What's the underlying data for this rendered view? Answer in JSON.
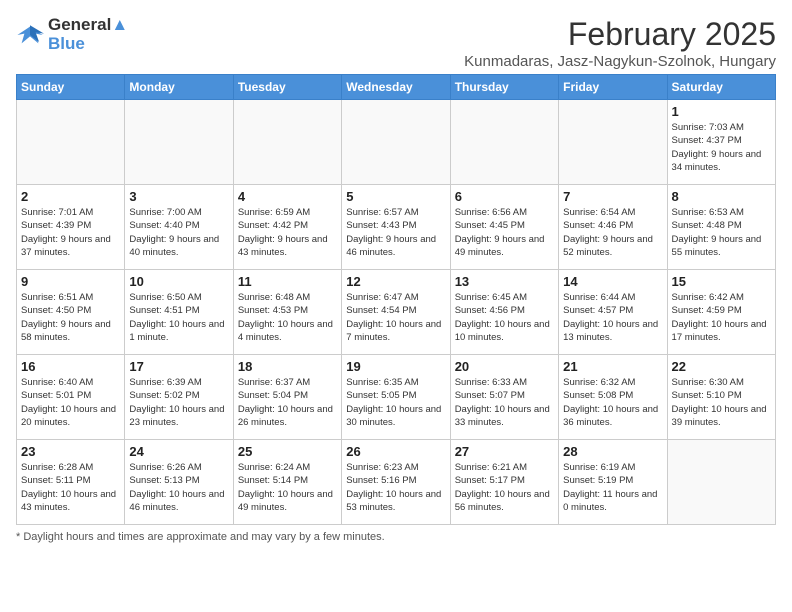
{
  "header": {
    "logo_line1": "General",
    "logo_line2": "Blue",
    "month_year": "February 2025",
    "location": "Kunmadaras, Jasz-Nagykun-Szolnok, Hungary"
  },
  "days_of_week": [
    "Sunday",
    "Monday",
    "Tuesday",
    "Wednesday",
    "Thursday",
    "Friday",
    "Saturday"
  ],
  "weeks": [
    [
      {
        "day": "",
        "info": ""
      },
      {
        "day": "",
        "info": ""
      },
      {
        "day": "",
        "info": ""
      },
      {
        "day": "",
        "info": ""
      },
      {
        "day": "",
        "info": ""
      },
      {
        "day": "",
        "info": ""
      },
      {
        "day": "1",
        "info": "Sunrise: 7:03 AM\nSunset: 4:37 PM\nDaylight: 9 hours and 34 minutes."
      }
    ],
    [
      {
        "day": "2",
        "info": "Sunrise: 7:01 AM\nSunset: 4:39 PM\nDaylight: 9 hours and 37 minutes."
      },
      {
        "day": "3",
        "info": "Sunrise: 7:00 AM\nSunset: 4:40 PM\nDaylight: 9 hours and 40 minutes."
      },
      {
        "day": "4",
        "info": "Sunrise: 6:59 AM\nSunset: 4:42 PM\nDaylight: 9 hours and 43 minutes."
      },
      {
        "day": "5",
        "info": "Sunrise: 6:57 AM\nSunset: 4:43 PM\nDaylight: 9 hours and 46 minutes."
      },
      {
        "day": "6",
        "info": "Sunrise: 6:56 AM\nSunset: 4:45 PM\nDaylight: 9 hours and 49 minutes."
      },
      {
        "day": "7",
        "info": "Sunrise: 6:54 AM\nSunset: 4:46 PM\nDaylight: 9 hours and 52 minutes."
      },
      {
        "day": "8",
        "info": "Sunrise: 6:53 AM\nSunset: 4:48 PM\nDaylight: 9 hours and 55 minutes."
      }
    ],
    [
      {
        "day": "9",
        "info": "Sunrise: 6:51 AM\nSunset: 4:50 PM\nDaylight: 9 hours and 58 minutes."
      },
      {
        "day": "10",
        "info": "Sunrise: 6:50 AM\nSunset: 4:51 PM\nDaylight: 10 hours and 1 minute."
      },
      {
        "day": "11",
        "info": "Sunrise: 6:48 AM\nSunset: 4:53 PM\nDaylight: 10 hours and 4 minutes."
      },
      {
        "day": "12",
        "info": "Sunrise: 6:47 AM\nSunset: 4:54 PM\nDaylight: 10 hours and 7 minutes."
      },
      {
        "day": "13",
        "info": "Sunrise: 6:45 AM\nSunset: 4:56 PM\nDaylight: 10 hours and 10 minutes."
      },
      {
        "day": "14",
        "info": "Sunrise: 6:44 AM\nSunset: 4:57 PM\nDaylight: 10 hours and 13 minutes."
      },
      {
        "day": "15",
        "info": "Sunrise: 6:42 AM\nSunset: 4:59 PM\nDaylight: 10 hours and 17 minutes."
      }
    ],
    [
      {
        "day": "16",
        "info": "Sunrise: 6:40 AM\nSunset: 5:01 PM\nDaylight: 10 hours and 20 minutes."
      },
      {
        "day": "17",
        "info": "Sunrise: 6:39 AM\nSunset: 5:02 PM\nDaylight: 10 hours and 23 minutes."
      },
      {
        "day": "18",
        "info": "Sunrise: 6:37 AM\nSunset: 5:04 PM\nDaylight: 10 hours and 26 minutes."
      },
      {
        "day": "19",
        "info": "Sunrise: 6:35 AM\nSunset: 5:05 PM\nDaylight: 10 hours and 30 minutes."
      },
      {
        "day": "20",
        "info": "Sunrise: 6:33 AM\nSunset: 5:07 PM\nDaylight: 10 hours and 33 minutes."
      },
      {
        "day": "21",
        "info": "Sunrise: 6:32 AM\nSunset: 5:08 PM\nDaylight: 10 hours and 36 minutes."
      },
      {
        "day": "22",
        "info": "Sunrise: 6:30 AM\nSunset: 5:10 PM\nDaylight: 10 hours and 39 minutes."
      }
    ],
    [
      {
        "day": "23",
        "info": "Sunrise: 6:28 AM\nSunset: 5:11 PM\nDaylight: 10 hours and 43 minutes."
      },
      {
        "day": "24",
        "info": "Sunrise: 6:26 AM\nSunset: 5:13 PM\nDaylight: 10 hours and 46 minutes."
      },
      {
        "day": "25",
        "info": "Sunrise: 6:24 AM\nSunset: 5:14 PM\nDaylight: 10 hours and 49 minutes."
      },
      {
        "day": "26",
        "info": "Sunrise: 6:23 AM\nSunset: 5:16 PM\nDaylight: 10 hours and 53 minutes."
      },
      {
        "day": "27",
        "info": "Sunrise: 6:21 AM\nSunset: 5:17 PM\nDaylight: 10 hours and 56 minutes."
      },
      {
        "day": "28",
        "info": "Sunrise: 6:19 AM\nSunset: 5:19 PM\nDaylight: 11 hours and 0 minutes."
      },
      {
        "day": "",
        "info": ""
      }
    ]
  ],
  "footer": {
    "text": "Daylight hours"
  }
}
